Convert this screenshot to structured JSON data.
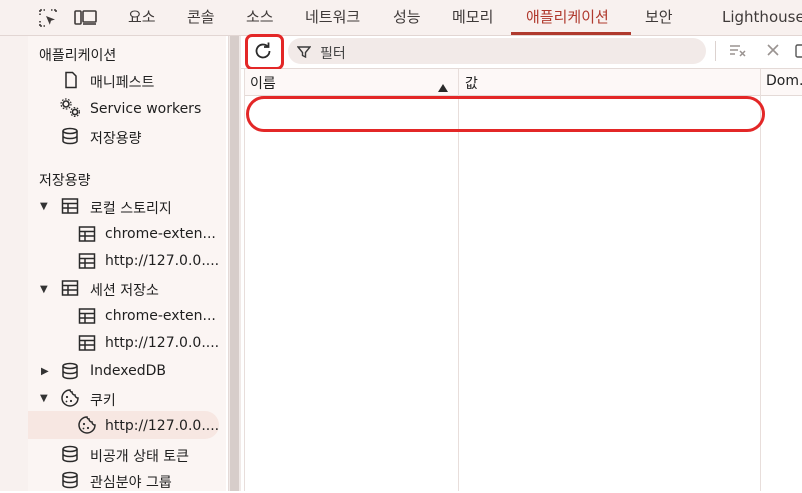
{
  "tabs": [
    {
      "label": "요소"
    },
    {
      "label": "콘솔"
    },
    {
      "label": "소스"
    },
    {
      "label": "네트워크"
    },
    {
      "label": "성능"
    },
    {
      "label": "메모리"
    },
    {
      "label": "애플리케이션"
    },
    {
      "label": "보안"
    },
    {
      "label": "Lighthouse"
    }
  ],
  "active_tab": "애플리케이션",
  "sidebar": {
    "app_section_title": "애플리케이션",
    "app_items": [
      {
        "label": "매니페스트",
        "icon": "file-icon"
      },
      {
        "label": "Service workers",
        "icon": "gears-icon"
      },
      {
        "label": "저장용량",
        "icon": "database-icon"
      }
    ],
    "storage_section_title": "저장용량",
    "local_storage": {
      "label": "로컬 스토리지",
      "children": [
        {
          "label": "chrome-exten..."
        },
        {
          "label": "http://127.0.0...."
        }
      ]
    },
    "session_storage": {
      "label": "세션 저장소",
      "children": [
        {
          "label": "chrome-exten..."
        },
        {
          "label": "http://127.0.0...."
        }
      ]
    },
    "indexeddb": {
      "label": "IndexedDB"
    },
    "cookies": {
      "label": "쿠키",
      "children": [
        {
          "label": "http://127.0.0...."
        }
      ]
    },
    "private_state_tokens": {
      "label": "비공개 상태 토큰"
    },
    "interest_groups": {
      "label": "관심분야 그룹"
    }
  },
  "toolbar": {
    "filter_placeholder": "필터"
  },
  "table": {
    "columns": [
      {
        "label": "이름"
      },
      {
        "label": "값"
      },
      {
        "label": "Dom..."
      }
    ]
  },
  "colors": {
    "accent": "#b03a2e",
    "highlight": "#e32727"
  }
}
